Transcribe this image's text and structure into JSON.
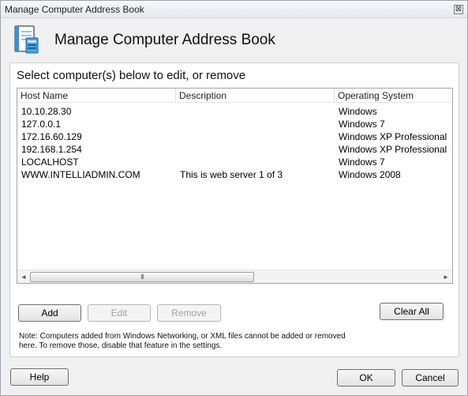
{
  "window": {
    "title": "Manage Computer Address Book",
    "close_glyph": "⊠"
  },
  "header": {
    "title": "Manage Computer Address Book",
    "icon": "document-computer-icon"
  },
  "panel": {
    "instruction": "Select computer(s) below to edit, or remove"
  },
  "list": {
    "columns": [
      "Host Name",
      "Description",
      "Operating System"
    ],
    "rows": [
      {
        "host": "10.10.28.30",
        "description": "",
        "os": "Windows"
      },
      {
        "host": "127.0.0.1",
        "description": "",
        "os": "Windows 7"
      },
      {
        "host": "172.16.60.129",
        "description": "",
        "os": "Windows XP Professional"
      },
      {
        "host": "192.168.1.254",
        "description": "",
        "os": "Windows XP Professional"
      },
      {
        "host": "LOCALHOST",
        "description": "",
        "os": "Windows 7"
      },
      {
        "host": "WWW.INTELLIADMIN.COM",
        "description": "This is web server 1 of 3",
        "os": "Windows 2008"
      }
    ],
    "scroll": {
      "left": "◄",
      "right": "►",
      "grip": "III"
    }
  },
  "buttons": {
    "add": "Add",
    "edit": "Edit",
    "remove": "Remove",
    "clear_all": "Clear All",
    "help": "Help",
    "ok": "OK",
    "cancel": "Cancel"
  },
  "note": "Note: Computers added from Windows Networking, or XML files cannot be added or removed here. To remove those, disable that feature in the settings."
}
